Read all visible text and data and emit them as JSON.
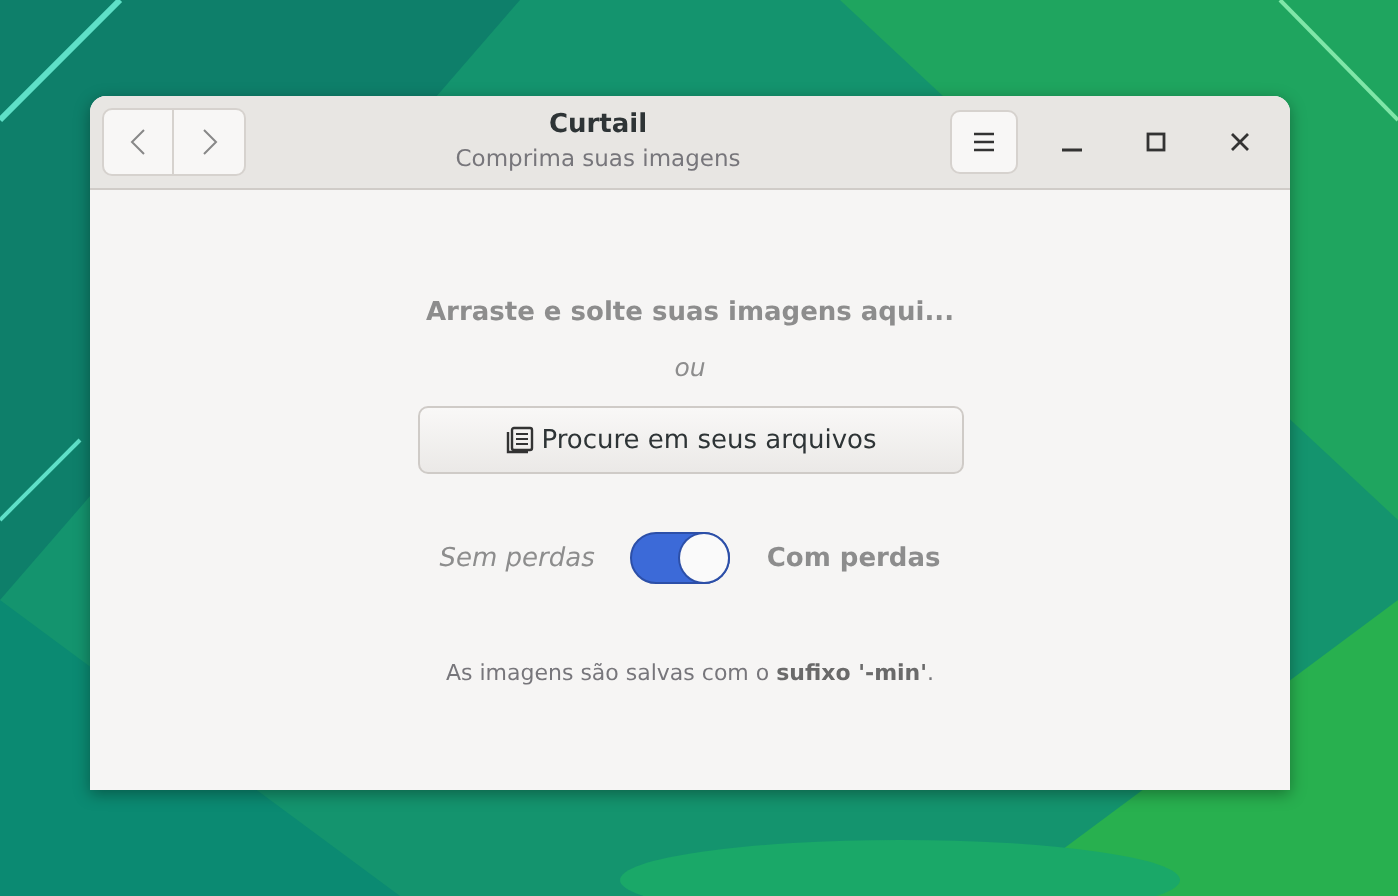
{
  "window": {
    "title": "Curtail",
    "subtitle": "Comprima suas imagens"
  },
  "drop_hint": "Arraste e solte suas imagens aqui...",
  "separator": "ou",
  "browse_button": "Procure em seus arquivos",
  "compression": {
    "left_label": "Sem perdas",
    "right_label": "Com perdas",
    "on": true
  },
  "footer": "As imagens são salvas com o **sufixo '-min'**."
}
